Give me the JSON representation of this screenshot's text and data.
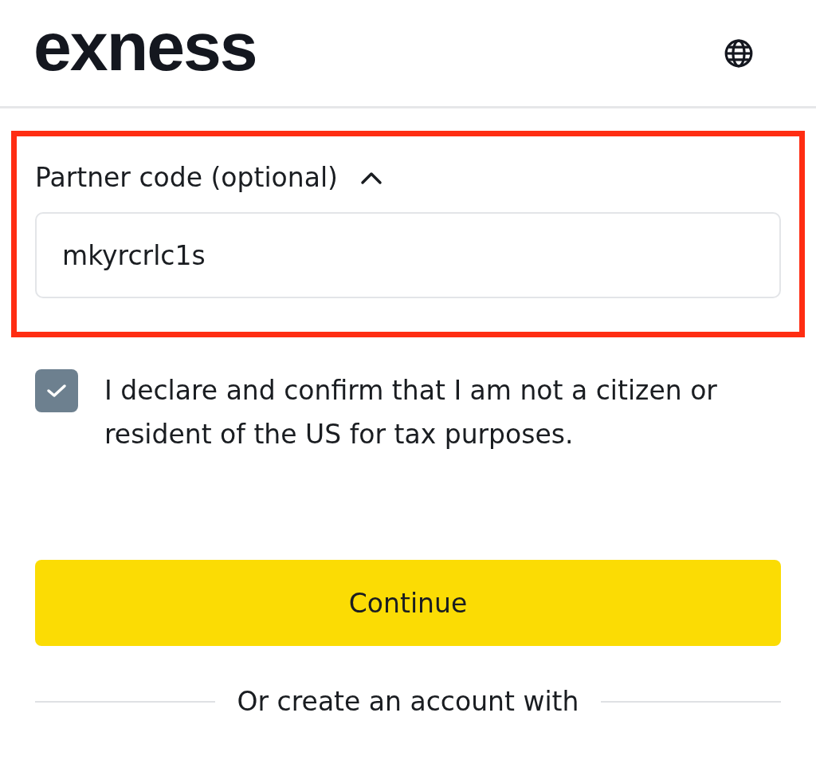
{
  "header": {
    "logo": "exness"
  },
  "partner_code": {
    "label": "Partner code (optional)",
    "expanded": true,
    "value": "mkyrcrlc1s",
    "highlighted": true
  },
  "declaration": {
    "label": "I declare and confirm that I am not a citizen or resident of the US for tax purposes.",
    "checked": true
  },
  "continue_button": "Continue",
  "alternative_divider": "Or create an account with"
}
